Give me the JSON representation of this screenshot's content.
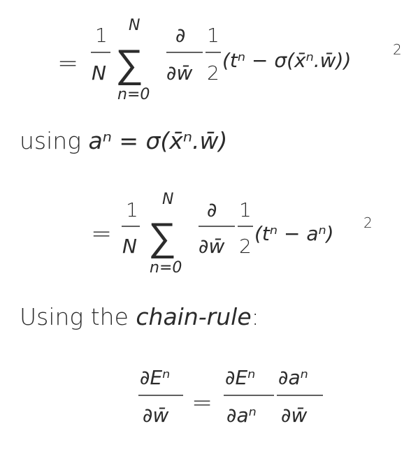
{
  "equation1": {
    "equals": "=",
    "frac_num": "1",
    "frac_den": "N",
    "sum_upper": "N",
    "sum_symbol": "∑",
    "sum_lower": "n=0",
    "partial_num": "∂",
    "partial_den": "∂w̄",
    "half_num": "1",
    "half_den": "2",
    "body": "(tⁿ − σ(x̄ⁿ.w̄))",
    "exponent": "2"
  },
  "using_line": {
    "prefix": "using",
    "expression": "aⁿ = σ(x̄ⁿ.w̄)"
  },
  "equation2": {
    "equals": "=",
    "frac_num": "1",
    "frac_den": "N",
    "sum_upper": "N",
    "sum_symbol": "∑",
    "sum_lower": "n=0",
    "partial_num": "∂",
    "partial_den": "∂w̄",
    "half_num": "1",
    "half_den": "2",
    "body": "(tⁿ − aⁿ)",
    "exponent": "2"
  },
  "chain_rule_line": {
    "prefix": "Using the",
    "emphasis": "chain-rule",
    "suffix": ":"
  },
  "equation3": {
    "lhs_num": "∂Eⁿ",
    "lhs_den": "∂w̄",
    "equals": "=",
    "rhs1_num": "∂Eⁿ",
    "rhs1_den": "∂aⁿ",
    "rhs2_num": "∂aⁿ",
    "rhs2_den": "∂w̄"
  }
}
